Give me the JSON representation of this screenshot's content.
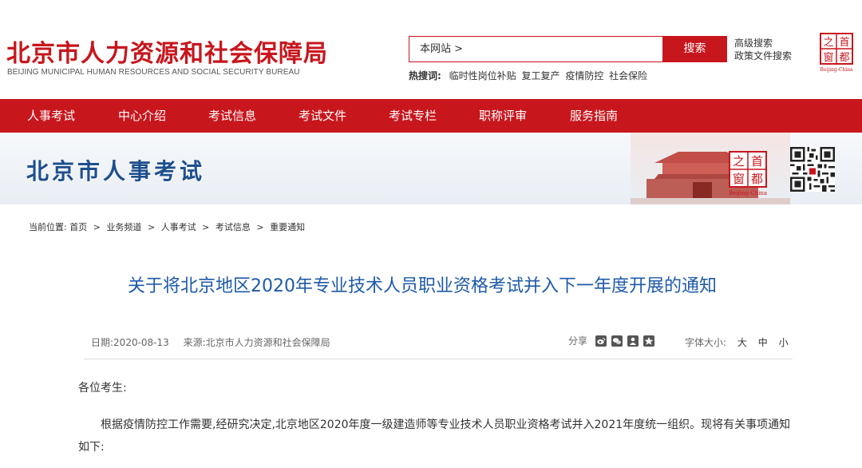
{
  "header": {
    "title": "北京市人力资源和社会保障局",
    "subtitle": "BEIJING MUNICIPAL HUMAN RESOURCES AND SOCIAL SECURITY BUREAU",
    "search_scope": "本网站 >",
    "search_button": "搜索",
    "advanced_search": "高级搜索",
    "policy_search": "政策文件搜索",
    "hotwords_label": "热搜词:",
    "hotwords": [
      "临时性岗位补贴",
      "复工复产",
      "疫情防控",
      "社会保险"
    ]
  },
  "nav": {
    "items": [
      "人事考试",
      "中心介绍",
      "考试信息",
      "考试文件",
      "考试专栏",
      "职称评审",
      "服务指南"
    ]
  },
  "banner": {
    "title": "北京市人事考试"
  },
  "breadcrumb": {
    "label": "当前位置:",
    "items": [
      "首页",
      "业务频道",
      "人事考试",
      "考试信息",
      "重要通知"
    ],
    "separator": ">"
  },
  "article": {
    "title": "关于将北京地区2020年专业技术人员职业资格考试并入下一年度开展的通知",
    "date": "日期:2020-08-13",
    "source": "来源:北京市人力资源和社会保障局",
    "share_label": "分享",
    "font_size_label": "字体大小:",
    "font_sizes": [
      "大",
      "中",
      "小"
    ],
    "greeting": "各位考生:",
    "paragraph1": "根据疫情防控工作需要,经研究决定,北京地区2020年度一级建造师等专业技术人员职业资格考试并入2021年度统一组织。现将有关事项通知如下:"
  },
  "colors": {
    "brand_red": "#c8161d",
    "title_blue": "#1e5aa8",
    "banner_blue": "#1e4f8e"
  },
  "seal": {
    "chars": [
      "之",
      "首",
      "窗",
      "都"
    ],
    "caption": "Beijing-China"
  }
}
